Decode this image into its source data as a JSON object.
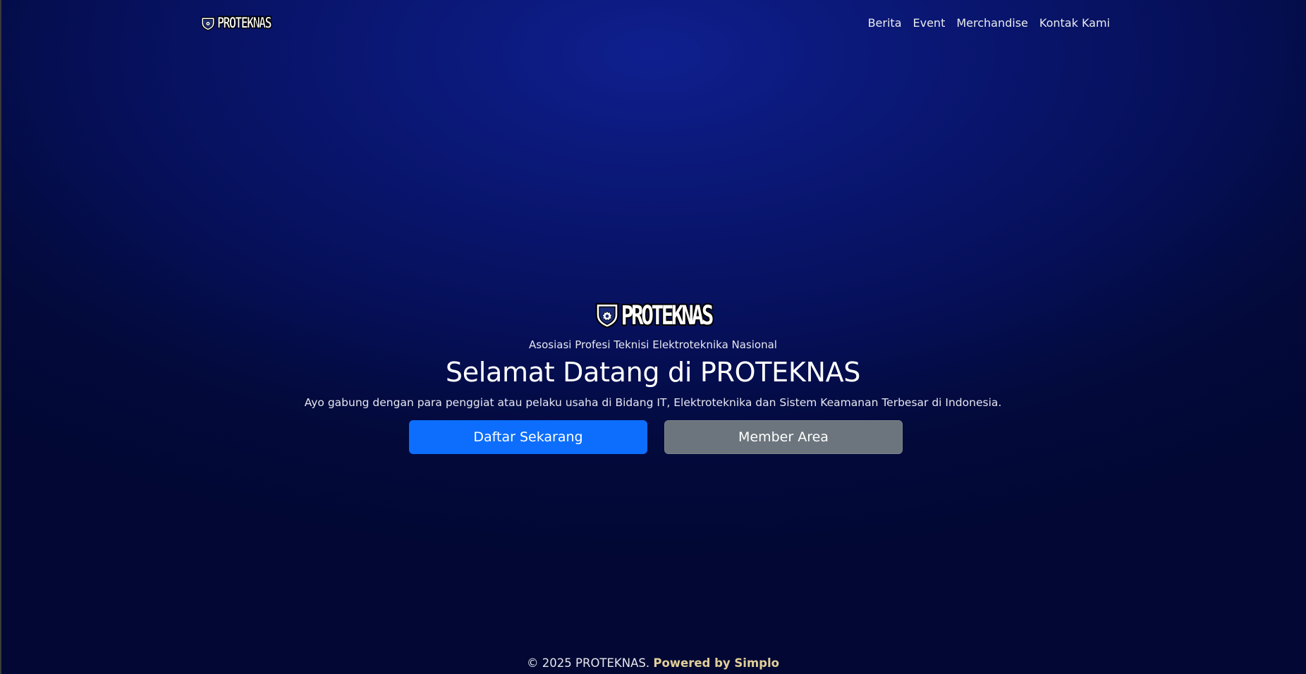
{
  "navbar": {
    "brand_text": "PROTEKNAS",
    "links": [
      "Berita",
      "Event",
      "Merchandise",
      "Kontak Kami"
    ]
  },
  "hero": {
    "logo_text": "PROTEKNAS",
    "tagline": "Asosiasi Profesi Teknisi Elektroteknika Nasional",
    "title": "Selamat Datang di PROTEKNAS",
    "lead": "Ayo gabung dengan para penggiat atau pelaku usaha di Bidang IT, Elektroteknika dan Sistem Keamanan Terbesar di Indonesia.",
    "primary_button": "Daftar Sekarang",
    "secondary_button": "Member Area"
  },
  "footer": {
    "copyright": "© 2025 PROTEKNAS.",
    "powered_by": "Powered by Simplo"
  },
  "colors": {
    "background_top": "#0f1f8e",
    "background_bottom": "#020833",
    "primary_button": "#0d6efd",
    "secondary_button": "#6c757d",
    "powered_by_accent": "#e2cf9a"
  },
  "icons": {
    "brand_logo": "proteknas-shield-icon"
  }
}
